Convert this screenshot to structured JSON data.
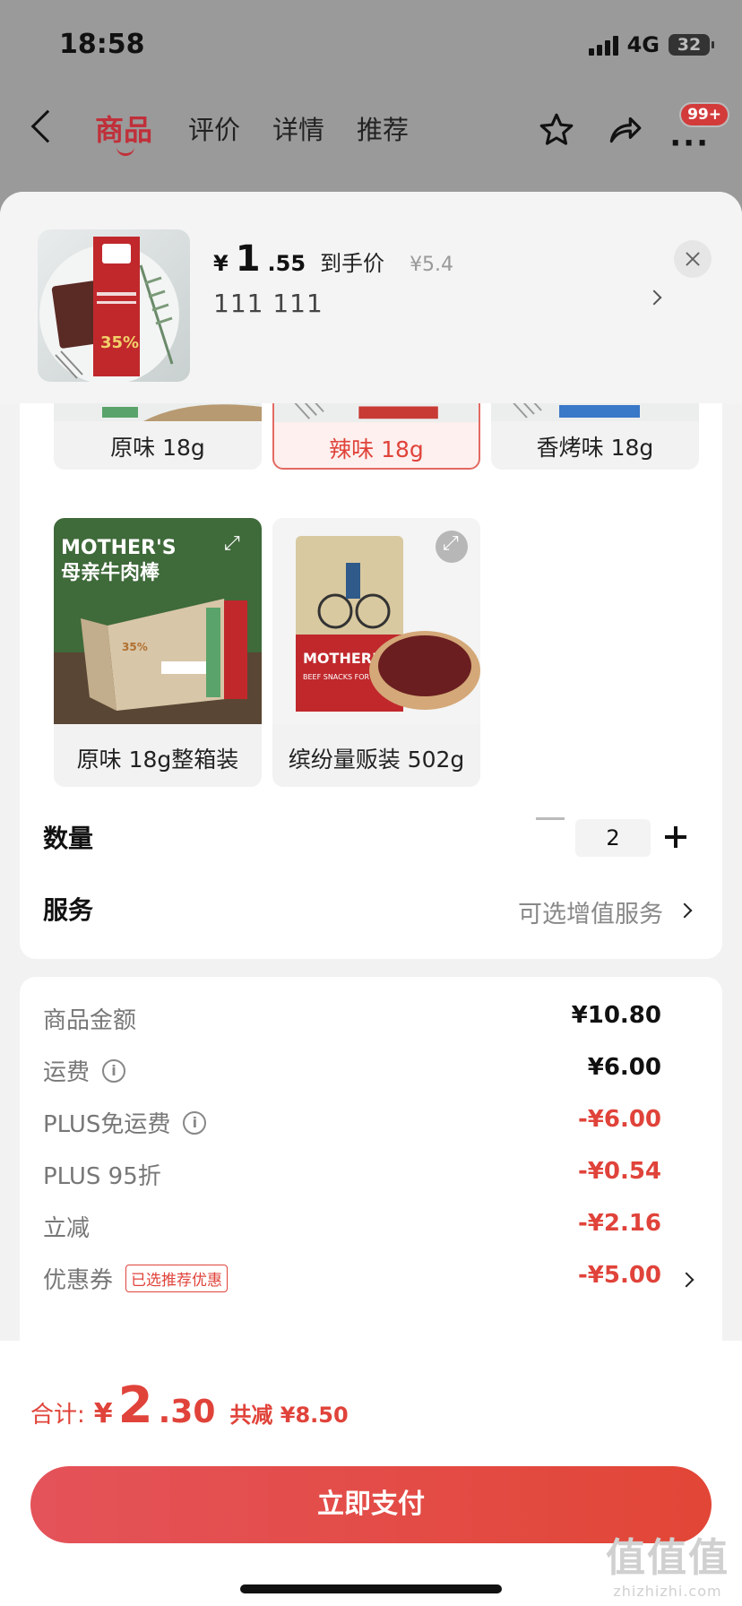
{
  "status_bar": {
    "time": "18:58",
    "network": "4G",
    "battery": "32"
  },
  "nav": {
    "tabs": [
      {
        "label": "商品",
        "active": true
      },
      {
        "label": "评价",
        "active": false
      },
      {
        "label": "详情",
        "active": false
      },
      {
        "label": "推荐",
        "active": false
      }
    ],
    "badge": "99+"
  },
  "product": {
    "currency": "¥",
    "price_integer": "1",
    "price_decimal": ".55",
    "price_tag": "到手价",
    "original_price": "¥5.4",
    "selected_spec": "111  111"
  },
  "variants": [
    {
      "label": "原味 18g",
      "selected": false,
      "color": "#5aa36a"
    },
    {
      "label": "辣味 18g",
      "selected": true,
      "color": "#c83a34"
    },
    {
      "label": "香烤味 18g",
      "selected": false,
      "color": "#3a78c8"
    },
    {
      "label": "原味 18g整箱装",
      "selected": false,
      "image_text": "MOTHER'S",
      "image_subtext": "母亲牛肉棒"
    },
    {
      "label": "缤纷量贩装 502g",
      "selected": false,
      "image_text": "MOTHER'S",
      "image_subtext": "BEEF SNACKS FOR"
    }
  ],
  "quantity": {
    "label": "数量",
    "value": "2"
  },
  "service": {
    "label": "服务",
    "value": "可选增值服务"
  },
  "summary": [
    {
      "label": "商品金额",
      "value": "¥10.80",
      "red": false,
      "info": false
    },
    {
      "label": "运费",
      "value": "¥6.00",
      "red": false,
      "info": true
    },
    {
      "label": "PLUS免运费",
      "value": "-¥6.00",
      "red": true,
      "info": true
    },
    {
      "label": "PLUS 95折",
      "value": "-¥0.54",
      "red": true,
      "info": false
    },
    {
      "label": "立减",
      "value": "-¥2.16",
      "red": true,
      "info": false
    },
    {
      "label": "优惠券",
      "value": "-¥5.00",
      "red": true,
      "info": false,
      "tag": "已选推荐优惠"
    }
  ],
  "footer": {
    "total_label": "合计:",
    "total_currency": "¥",
    "total_integer": "2",
    "total_decimal": ".30",
    "saved": "共减 ¥8.50",
    "pay_button": "立即支付"
  },
  "watermark": {
    "big": "值值值",
    "small": "zhizhizhi.com"
  },
  "colors": {
    "accent": "#e0433a",
    "nav_active": "#c0303a"
  }
}
